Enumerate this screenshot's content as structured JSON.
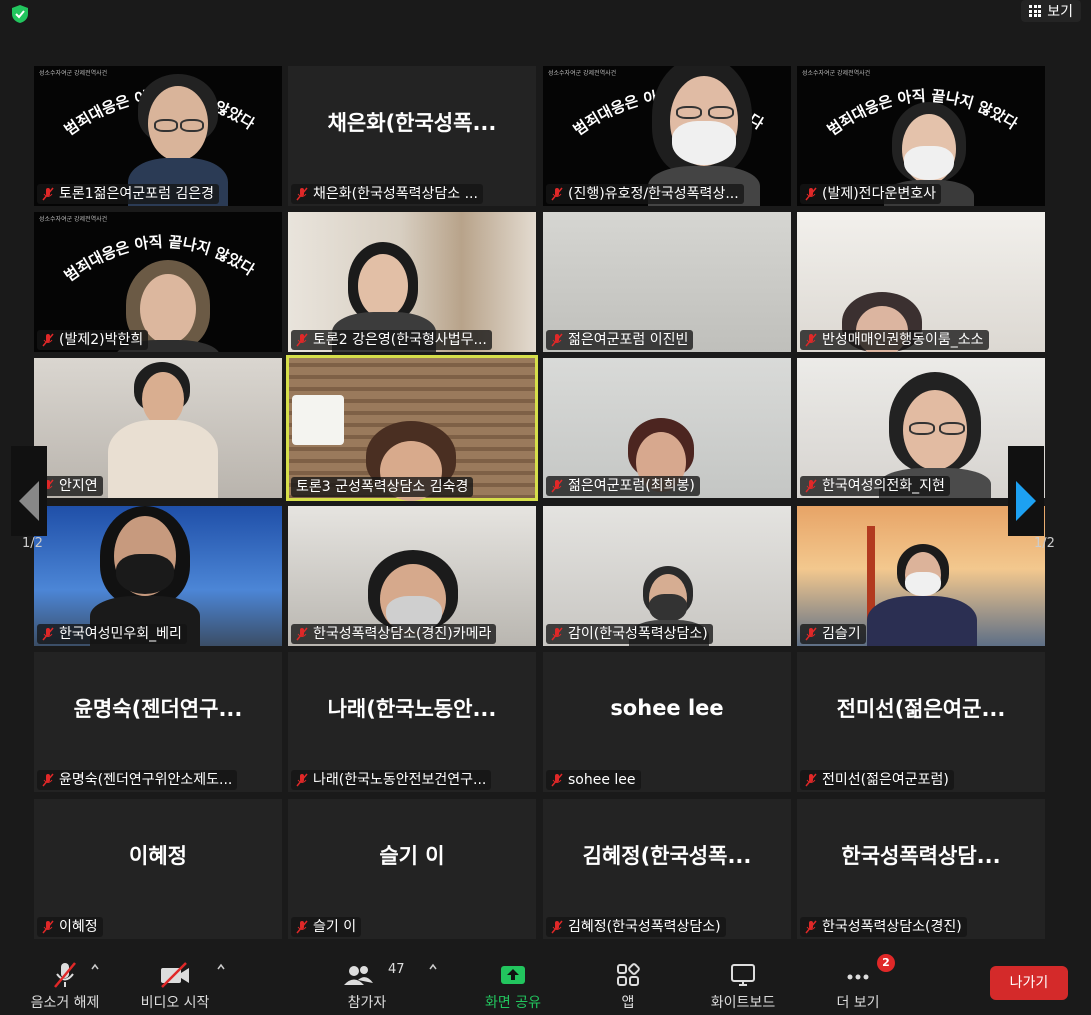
{
  "topbar": {
    "view_label": "보기"
  },
  "paging": {
    "left_page": "1/2",
    "right_page": "1/2"
  },
  "tiles": [
    {
      "label": "토론1젊은여군포럼 김은경",
      "center": ""
    },
    {
      "label": "채은화(한국성폭력상담소 ...",
      "center": "채은화(한국성폭..."
    },
    {
      "label": "(진행)유호정/한국성폭력상...",
      "center": ""
    },
    {
      "label": "(발제)전다운변호사",
      "center": ""
    },
    {
      "label": "(발제2)박한희",
      "center": ""
    },
    {
      "label": "토론2 강은영(한국형사법무...",
      "center": ""
    },
    {
      "label": "젊은여군포럼 이진빈",
      "center": ""
    },
    {
      "label": "반성매매인권행동이룸_소소",
      "center": ""
    },
    {
      "label": "안지연",
      "center": ""
    },
    {
      "label": "토론3 군성폭력상담소 김숙경",
      "center": ""
    },
    {
      "label": "젊은여군포럼(최희봉)",
      "center": ""
    },
    {
      "label": "한국여성의전화_지현",
      "center": ""
    },
    {
      "label": "한국여성민우회_베리",
      "center": ""
    },
    {
      "label": "한국성폭력상담소(경진)카메라",
      "center": ""
    },
    {
      "label": "감이(한국성폭력상담소)",
      "center": ""
    },
    {
      "label": "김슬기",
      "center": ""
    },
    {
      "label": "윤명숙(젠더연구위안소제도...",
      "center": "윤명숙(젠더연구..."
    },
    {
      "label": "나래(한국노동안전보건연구...",
      "center": "나래(한국노동안..."
    },
    {
      "label": "sohee lee",
      "center": "sohee lee"
    },
    {
      "label": "전미선(젊은여군포럼)",
      "center": "전미선(젊은여군..."
    },
    {
      "label": "이혜정",
      "center": "이혜정"
    },
    {
      "label": "슬기 이",
      "center": "슬기 이"
    },
    {
      "label": "김혜정(한국성폭력상담소)",
      "center": "김혜정(한국성폭..."
    },
    {
      "label": "한국성폭력상담소(경진)",
      "center": "한국성폭력상담..."
    }
  ],
  "banner": {
    "arc_text": "범죄대응은 아직 끝나지 않았다",
    "tiny": "성소수자여군 강제전역사건"
  },
  "toolbar": {
    "unmute": "음소거 해제",
    "start_video": "비디오 시작",
    "participants": "참가자",
    "participant_count": "47",
    "share": "화면 공유",
    "apps": "앱",
    "whiteboard": "화이트보드",
    "more": "더 보기",
    "more_badge": "2",
    "leave": "나가기"
  },
  "colors": {
    "accent_green": "#22c55e",
    "leave_red": "#d42a2a",
    "active_border": "#d6df4a",
    "arrow_blue": "#1da1f2"
  }
}
